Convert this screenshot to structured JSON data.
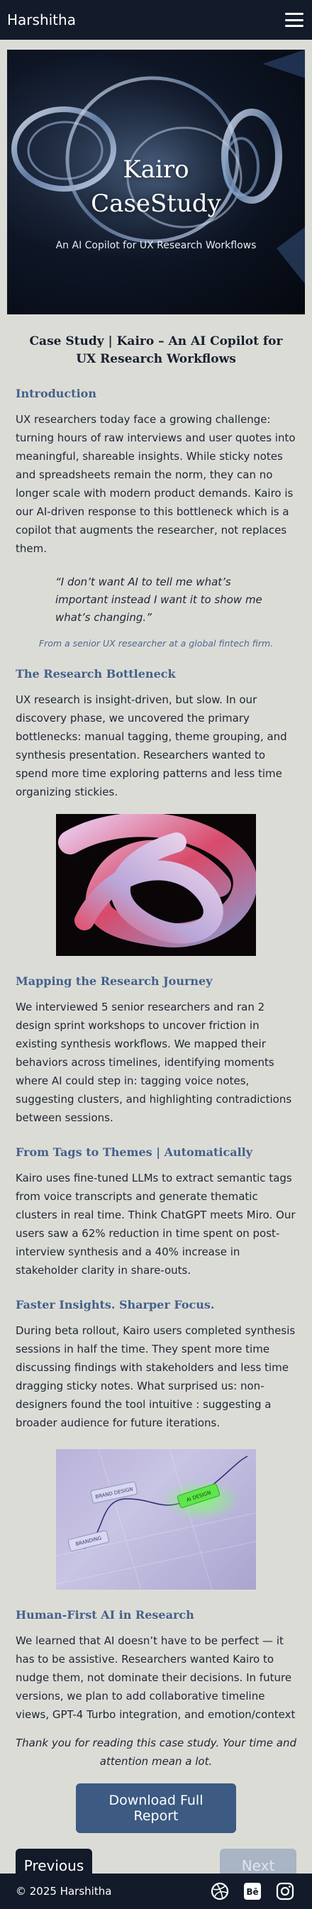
{
  "nav": {
    "brand": "Harshitha",
    "menu_icon": "hamburger-icon"
  },
  "hero": {
    "title_line1": "Kairo",
    "title_line2": "CaseStudy",
    "subtitle": "An AI Copilot for UX Research Workflows"
  },
  "page_title": "Case Study | Kairo – An AI Copilot for UX Research Workflows",
  "sections": {
    "intro": {
      "heading": "Introduction",
      "body": "UX researchers today face a growing challenge: turning hours of raw interviews and user quotes into meaningful, shareable insights. While sticky notes and spreadsheets remain the norm, they can no longer scale with modern product demands. Kairo is our AI-driven response to this bottleneck which is a copilot that augments the researcher, not replaces them."
    },
    "quote": {
      "text": "“I don’t want AI to tell me what’s important instead I want it to show me what’s changing.”",
      "source": "From a senior UX researcher at a global fintech firm."
    },
    "bottleneck": {
      "heading": "The Research Bottleneck",
      "body": "UX research is insight-driven, but slow. In our discovery phase, we uncovered the primary bottlenecks: manual tagging, theme grouping, and synthesis presentation. Researchers wanted to spend more time exploring patterns and less time organizing stickies."
    },
    "journey": {
      "heading": "Mapping the Research Journey",
      "body": "We interviewed 5 senior researchers and ran 2 design sprint workshops to uncover friction in existing synthesis workflows. We mapped their behaviors across timelines, identifying moments where AI could step in: tagging voice notes, suggesting clusters, and highlighting contradictions between sessions."
    },
    "themes": {
      "heading": "From Tags to Themes | Automatically",
      "body": "Kairo uses fine-tuned LLMs to extract semantic tags from voice transcripts and generate thematic clusters in real time. Think ChatGPT meets Miro. Our users saw a 62% reduction in time spent on post-interview synthesis and a 40% increase in stakeholder clarity in share-outs."
    },
    "faster": {
      "heading": "Faster Insights. Sharper Focus.",
      "body": "During beta rollout, Kairo users completed synthesis sessions in half the time. They spent more time discussing findings with stakeholders and less time dragging sticky notes. What surprised us: non-designers found the tool intuitive : suggesting a broader audience for future iterations."
    },
    "human": {
      "heading": "Human-First AI in Research",
      "body": "We learned that AI doesn’t have to be perfect — it has to be assistive. Researchers wanted Kairo to nudge them, not dominate their decisions. In future versions, we plan to add collaborative timeline views, GPT-4 Turbo integration, and emotion/context"
    }
  },
  "images": {
    "knot": "abstract-knot-image",
    "hand_labels": [
      "BRAND DESIGN",
      "AI DESIGN",
      "BRANDING"
    ]
  },
  "closing": "Thank you for reading this case study. Your time and attention mean a lot.",
  "buttons": {
    "download": "Download Full Report",
    "previous": "Previous",
    "next": "Next"
  },
  "footer": {
    "copyright": "© 2025 Harshitha",
    "socials": [
      "dribbble-icon",
      "behance-icon",
      "instagram-icon"
    ],
    "behance_label": "Bē"
  },
  "colors": {
    "nav_bg": "#131b2a",
    "page_bg": "#dcdcd7",
    "heading_accent": "#43618a",
    "download_button": "#3c5a82",
    "next_disabled": "#a9b4c4"
  }
}
